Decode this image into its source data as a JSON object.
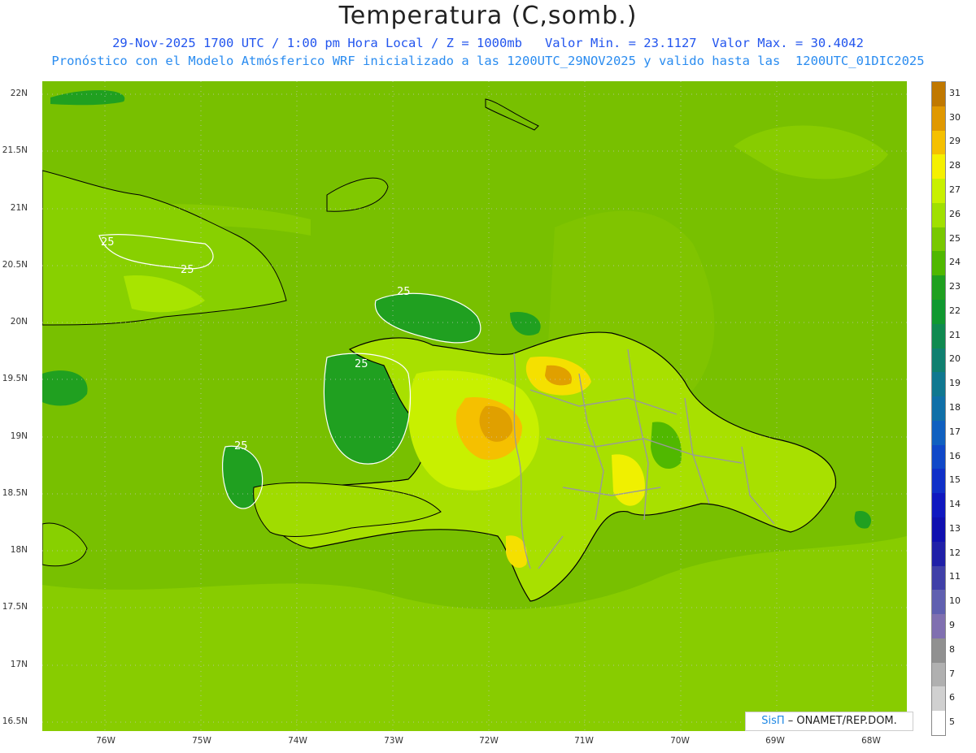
{
  "title": "Temperatura (C,somb.)",
  "subtitle_line1": "29-Nov-2025 1700 UTC / 1:00 pm Hora Local / Z = 1000mb   Valor Min. = 23.1127  Valor Max. = 30.4042",
  "subtitle_line2": "Pronóstico con el Modelo Atmósferico WRF inicializado a las 1200UTC_29NOV2025 y valido hasta las  1200UTC_01DIC2025",
  "lat_labels": [
    "22N",
    "21.5N",
    "21N",
    "20.5N",
    "20N",
    "19.5N",
    "19N",
    "18.5N",
    "18N",
    "17.5N",
    "17N",
    "16.5N"
  ],
  "lon_labels": [
    "76W",
    "75W",
    "74W",
    "73W",
    "72W",
    "71W",
    "70W",
    "69W",
    "68W"
  ],
  "contour_labels": [
    "25",
    "25",
    "25",
    "25",
    "25"
  ],
  "colorbar": {
    "levels": [
      "31",
      "30",
      "29",
      "28",
      "27",
      "26",
      "25",
      "24",
      "23",
      "22",
      "21",
      "20",
      "19",
      "18",
      "17",
      "16",
      "15",
      "14",
      "13",
      "12",
      "11",
      "10",
      "9",
      "8",
      "7",
      "6",
      "5"
    ],
    "colors": [
      "#c07800",
      "#e09800",
      "#f5c000",
      "#f5f000",
      "#c8f000",
      "#a0e000",
      "#78c800",
      "#50b800",
      "#20a020",
      "#109830",
      "#108a50",
      "#108070",
      "#107890",
      "#1070a8",
      "#1060c0",
      "#1048c8",
      "#1030c8",
      "#1018c0",
      "#1010b0",
      "#2020a8",
      "#4040a8",
      "#6060b0",
      "#8070b0",
      "#909090",
      "#b0b0b0",
      "#d0d0d0",
      "#ffffff"
    ]
  },
  "credit": {
    "brand": "SisΠ",
    "text": " – ONAMET/REP.DOM."
  },
  "colors": {
    "ocean": "#78c000",
    "sea_light": "#88cc00",
    "land_warm": "#c8f000",
    "hot": "#f5c000",
    "cool": "#20a020"
  }
}
